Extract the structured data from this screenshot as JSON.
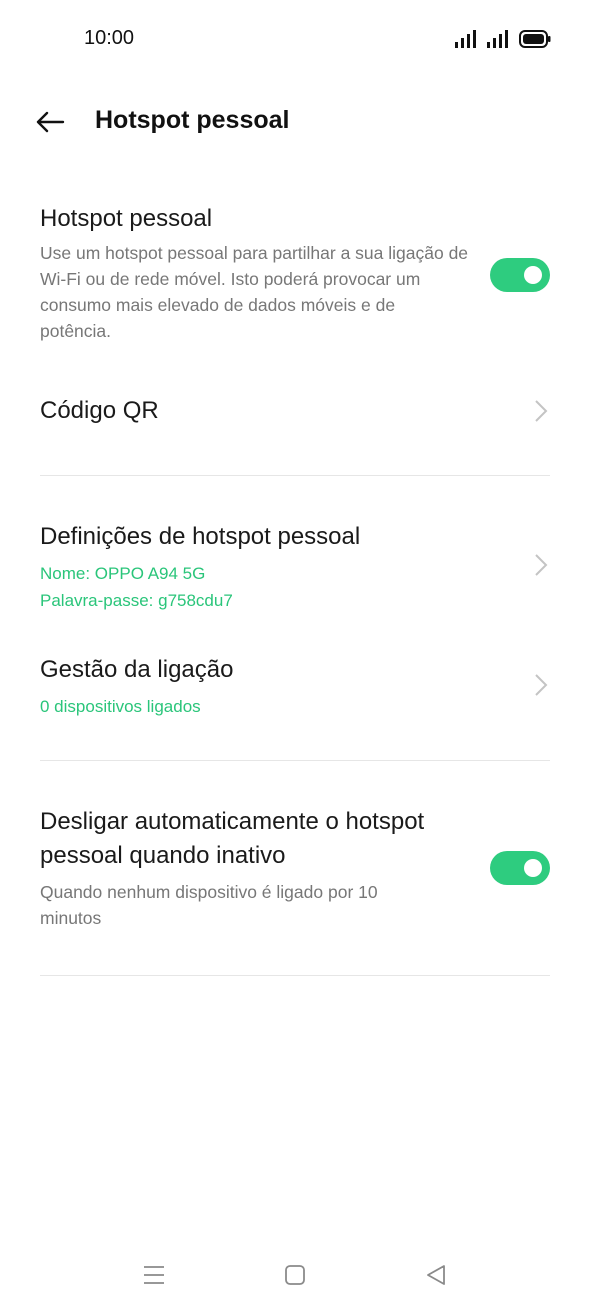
{
  "status_bar": {
    "time": "10:00",
    "icons": [
      "signal-icon",
      "signal-icon",
      "battery-icon"
    ]
  },
  "app_bar": {
    "title": "Hotspot pessoal",
    "back_icon": "back-arrow-icon"
  },
  "hotspot": {
    "title": "Hotspot pessoal",
    "description": "Use um hotspot pessoal para partilhar a sua ligação de Wi-Fi ou de rede móvel. Isto poderá provocar um consumo mais elevado de dados móveis e de potência.",
    "enabled": true
  },
  "qr_code": {
    "title": "Código QR"
  },
  "hotspot_settings": {
    "title": "Definições de hotspot pessoal",
    "name": "Nome: OPPO A94 5G",
    "password": "Palavra-passe: g758cdu7"
  },
  "connection_management": {
    "title": "Gestão da ligação",
    "subtitle": "0 dispositivos ligados"
  },
  "auto_off": {
    "title": "Desligar automaticamente o hotspot pessoal quando inativo",
    "description": "Quando nenhum dispositivo é ligado por 10 minutos",
    "enabled": true
  },
  "colors": {
    "accent": "#2ecc7f",
    "subtext_green": "#2ac57a",
    "description_gray": "#777777",
    "divider": "#e6e6e6"
  },
  "nav_bar": {
    "icons": [
      "menu-icon",
      "home-icon",
      "back-icon"
    ]
  }
}
